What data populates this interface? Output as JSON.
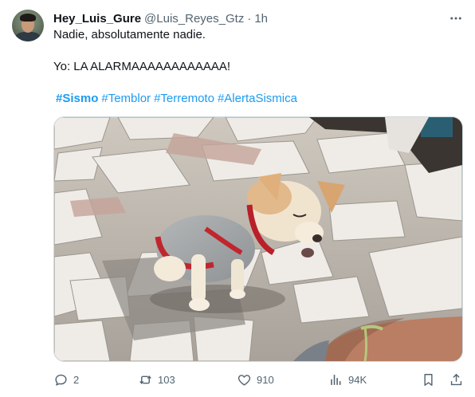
{
  "tweet": {
    "author": {
      "display_name": "Hey_Luis_Gure",
      "handle": "@Luis_Reyes_Gtz",
      "separator": "·",
      "time": "1h"
    },
    "more_icon": "more-horizontal-icon",
    "text_line1": "Nadie, absolutamente nadie.",
    "text_line2": "Yo: LA ALARMAAAAAAAAAAAA!",
    "hashtags": [
      "#Sismo",
      "#Temblor",
      "#Terremoto",
      "#AlertaSismica"
    ],
    "media": {
      "kind": "photo"
    },
    "actions": {
      "replies": "2",
      "retweets": "103",
      "likes": "910",
      "views": "94K"
    }
  },
  "colors": {
    "text": "#0f1419",
    "secondary": "#536471",
    "accent": "#1d9bf0",
    "border": "#cfd9de"
  }
}
